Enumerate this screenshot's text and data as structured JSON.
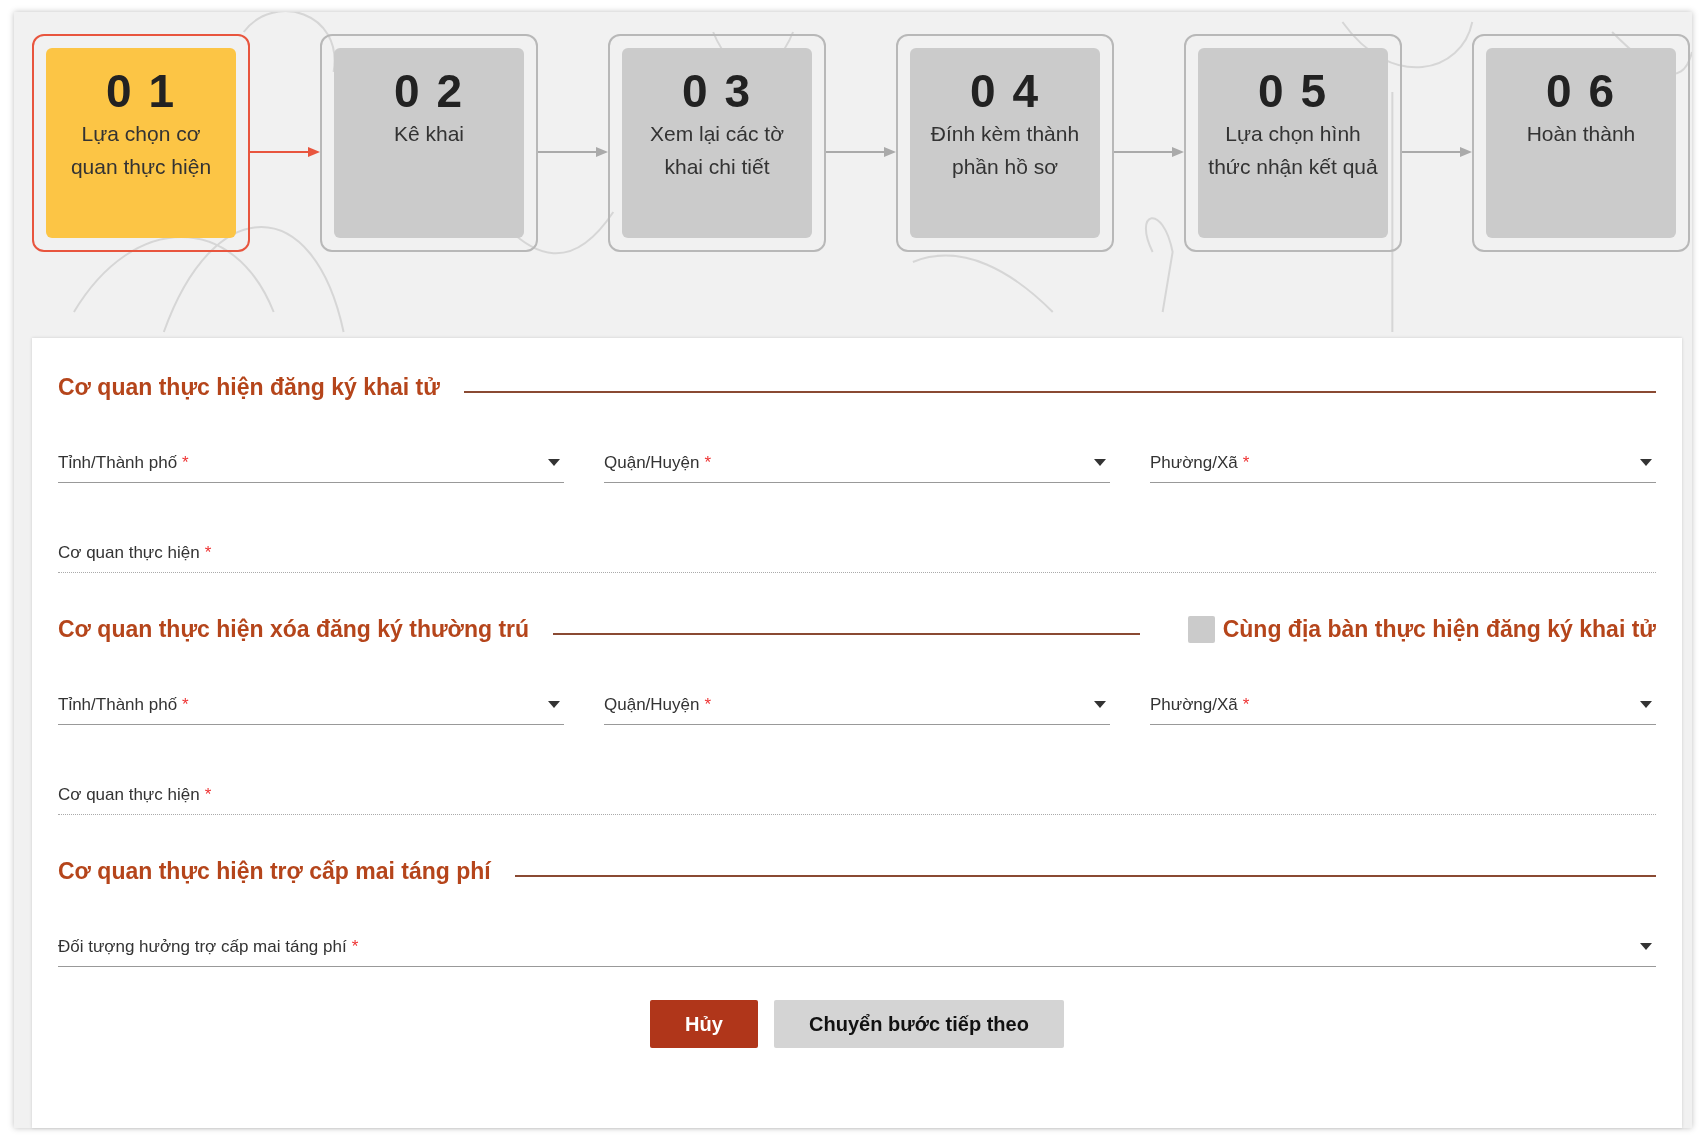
{
  "steps": [
    {
      "number": "0 1",
      "label": "Lựa chọn cơ quan thực hiện",
      "selected": true
    },
    {
      "number": "0 2",
      "label": "Kê khai",
      "selected": false
    },
    {
      "number": "0 3",
      "label": "Xem lại các tờ khai chi tiết",
      "selected": false
    },
    {
      "number": "0 4",
      "label": "Đính kèm thành phần hồ sơ",
      "selected": false
    },
    {
      "number": "0 5",
      "label": "Lựa chọn hình thức nhận kết quả",
      "selected": false
    },
    {
      "number": "0 6",
      "label": "Hoàn thành",
      "selected": false
    }
  ],
  "sections": [
    {
      "title": "Cơ quan thực hiện đăng ký khai tử",
      "rows": [
        [
          {
            "kind": "select",
            "label": "Tỉnh/Thành phố",
            "required_mark": "*"
          },
          {
            "kind": "select",
            "label": "Quận/Huyện",
            "required_mark": "*"
          },
          {
            "kind": "select",
            "label": "Phường/Xã",
            "required_mark": "*"
          }
        ],
        [
          {
            "kind": "text",
            "label": "Cơ quan thực hiện",
            "required_mark": "*"
          }
        ]
      ]
    },
    {
      "title": "Cơ quan thực hiện xóa đăng ký thường trú",
      "checkbox": {
        "label": "Cùng địa bàn thực hiện đăng ký khai tử",
        "checked": false
      },
      "rows": [
        [
          {
            "kind": "select",
            "label": "Tỉnh/Thành phố",
            "required_mark": "*"
          },
          {
            "kind": "select",
            "label": "Quận/Huyện",
            "required_mark": "*"
          },
          {
            "kind": "select",
            "label": "Phường/Xã",
            "required_mark": "*"
          }
        ],
        [
          {
            "kind": "text",
            "label": "Cơ quan thực hiện",
            "required_mark": "*"
          }
        ]
      ]
    },
    {
      "title": "Cơ quan thực hiện trợ cấp mai táng phí",
      "rows": [
        [
          {
            "kind": "select",
            "label": "Đối tượng hưởng trợ cấp mai táng phí",
            "required_mark": "*"
          }
        ]
      ]
    }
  ],
  "buttons": [
    {
      "label": "Hủy",
      "kind": "primary"
    },
    {
      "label": "Chuyển bước tiếp theo",
      "kind": "secondary"
    }
  ]
}
